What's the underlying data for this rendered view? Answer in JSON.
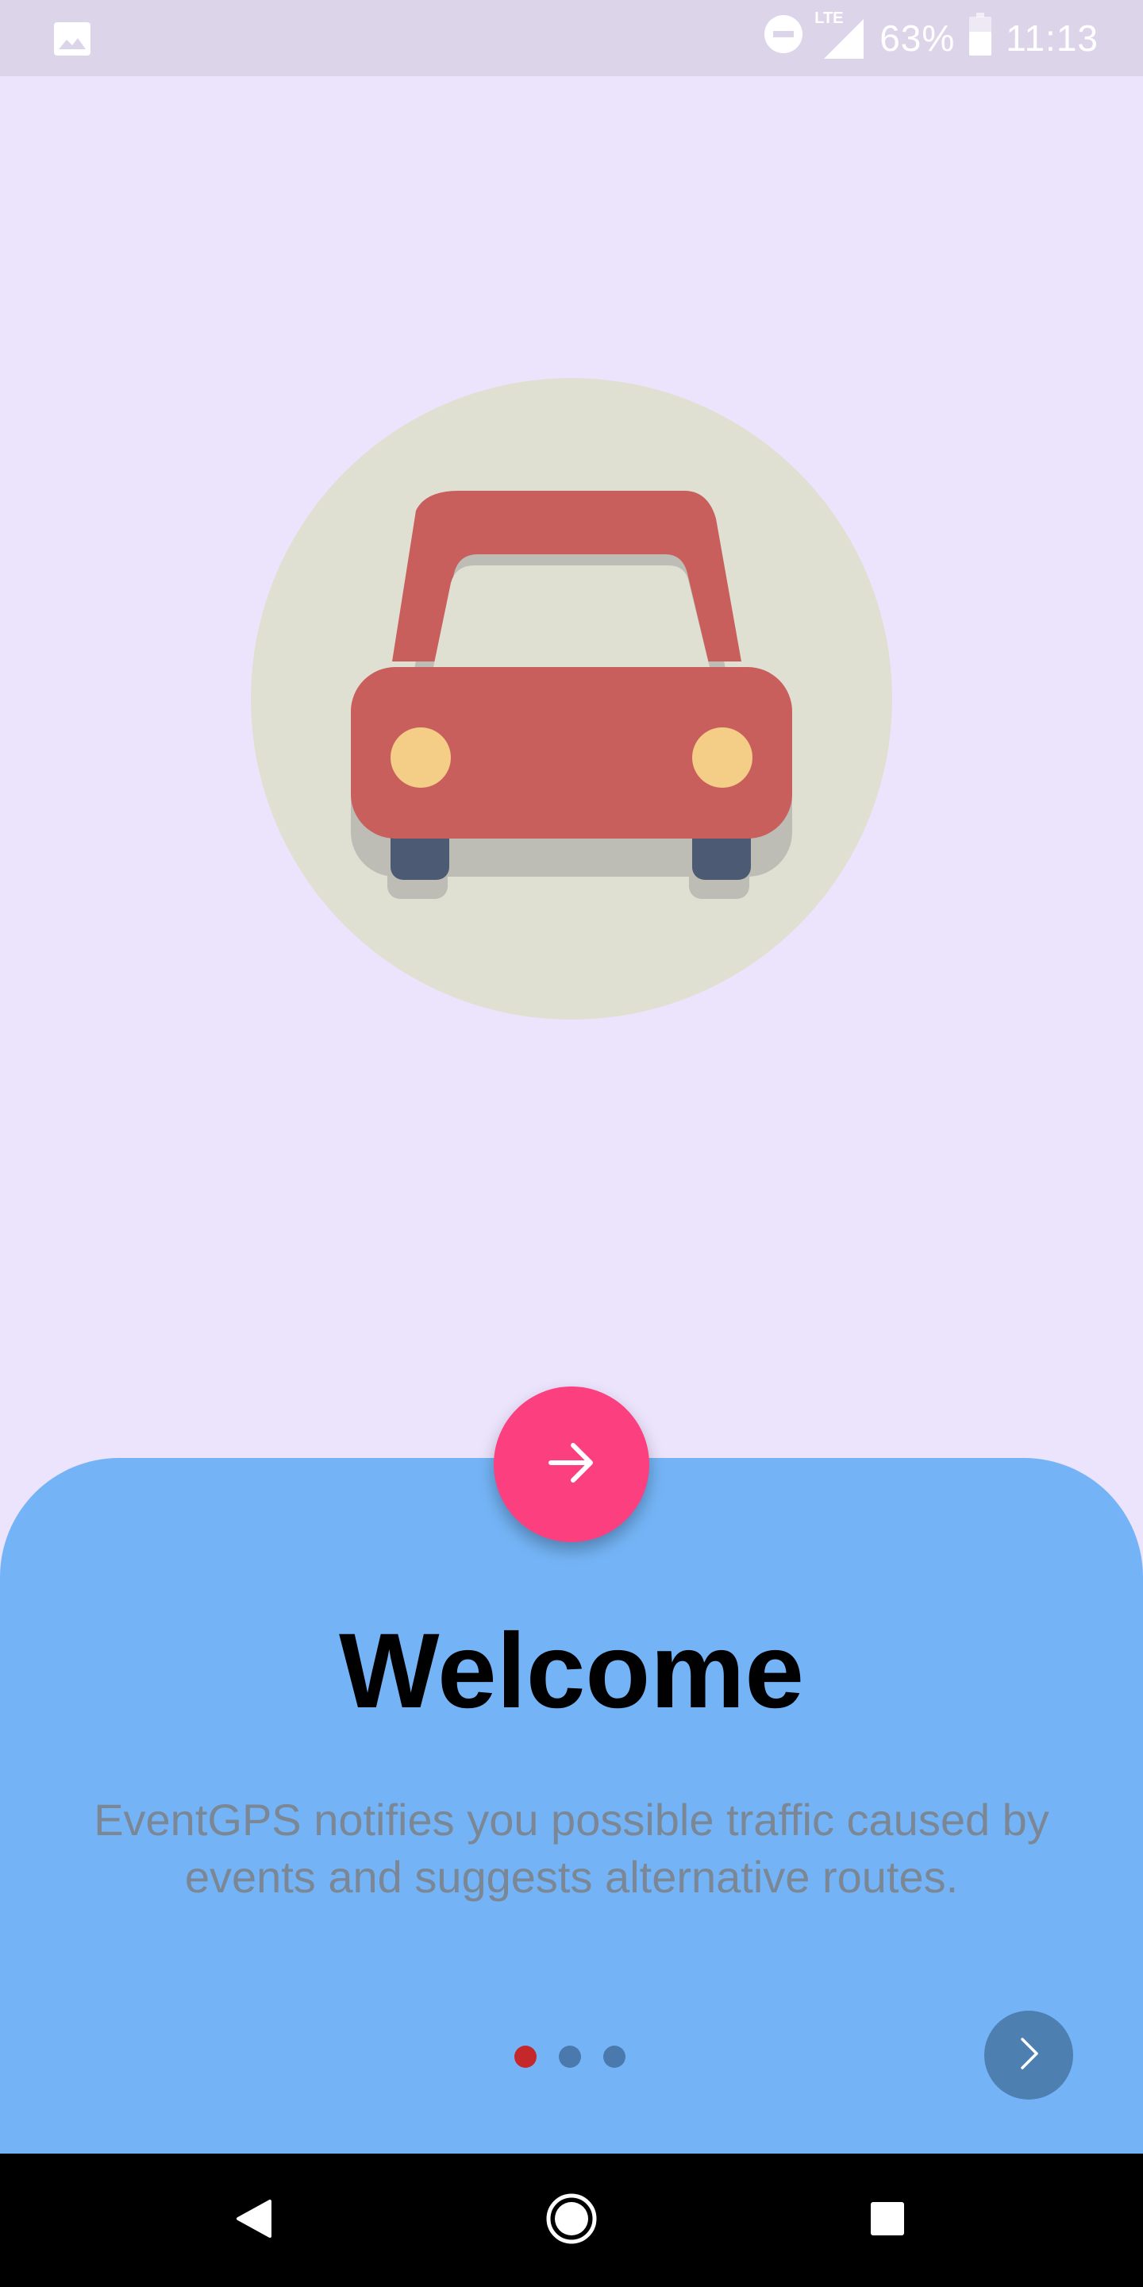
{
  "status_bar": {
    "battery_percent": "63%",
    "time": "11:13",
    "network_label": "LTE",
    "icons": [
      "image-icon",
      "do-not-disturb-icon",
      "lte-signal-icon",
      "battery-icon"
    ]
  },
  "illustration": {
    "icon": "car-icon",
    "circle_color": "#e0e0d2",
    "car_color": "#c95f5d",
    "headlight_color": "#f4cd87",
    "wheel_color": "#4d5a73"
  },
  "onboarding": {
    "title": "Welcome",
    "description": "EventGPS notifies you possible traffic caused by events and suggests alternative routes.",
    "page_count": 3,
    "current_page": 1,
    "fab_icon": "arrow-right-icon",
    "next_icon": "chevron-right-icon"
  },
  "colors": {
    "background": "#ece4fd",
    "sheet": "#74b4f6",
    "fab": "#fc407f",
    "active_dot": "#c4282b",
    "inactive_dot": "#4a7aad",
    "next_button": "#4d7fb1"
  },
  "nav_bar": {
    "icons": [
      "back-icon",
      "home-icon",
      "recents-icon"
    ]
  }
}
